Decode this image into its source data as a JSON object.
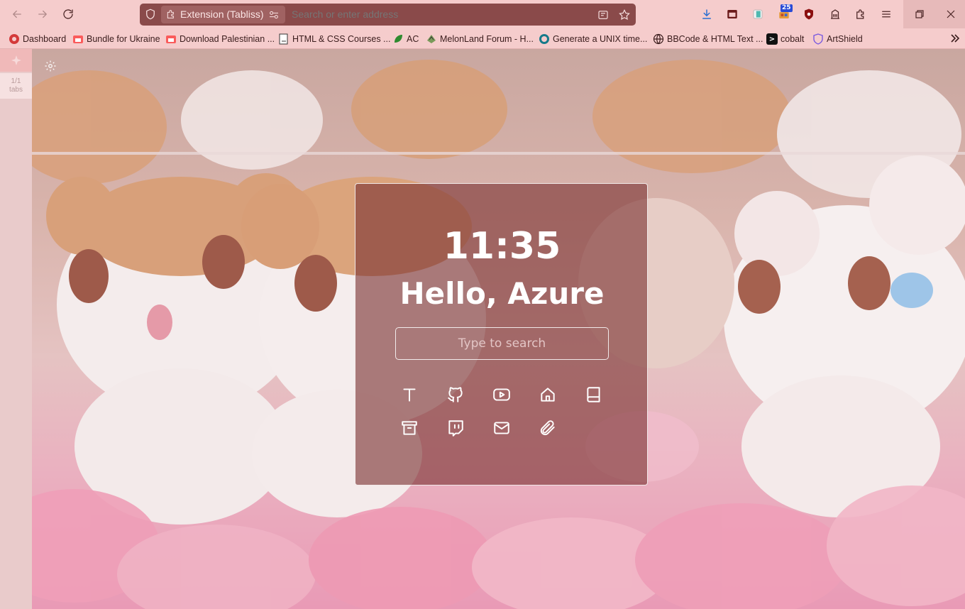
{
  "browser": {
    "identity_label": "Extension (Tabliss)",
    "url_placeholder": "Search or enter address",
    "download_badge": "25"
  },
  "bookmarks": [
    {
      "label": "Dashboard",
      "icon": "gear-red-icon"
    },
    {
      "label": "Bundle for Ukraine",
      "icon": "itch-icon"
    },
    {
      "label": "Download Palestinian ...",
      "icon": "itch-icon"
    },
    {
      "label": "HTML & CSS Courses ...",
      "icon": "page-icon"
    },
    {
      "label": "AC",
      "icon": "leaf-icon"
    },
    {
      "label": "MelonLand Forum - H...",
      "icon": "melon-icon"
    },
    {
      "label": "Generate a UNIX time...",
      "icon": "clock-teal-icon"
    },
    {
      "label": "BBCode & HTML Text ...",
      "icon": "globe-icon"
    },
    {
      "label": "cobalt",
      "icon": "terminal-icon"
    },
    {
      "label": "ArtShield",
      "icon": "shield-purple-icon"
    }
  ],
  "sidebar": {
    "tab_count": "1/1",
    "tab_word": "tabs"
  },
  "dashboard": {
    "time": "11:35",
    "greeting": "Hello, Azure",
    "search_placeholder": "Type to search",
    "links": [
      {
        "icon": "text-icon"
      },
      {
        "icon": "github-icon"
      },
      {
        "icon": "youtube-icon"
      },
      {
        "icon": "home-icon"
      },
      {
        "icon": "book-icon"
      },
      {
        "icon": "archive-icon"
      },
      {
        "icon": "twitch-icon"
      },
      {
        "icon": "mail-icon"
      },
      {
        "icon": "paperclip-icon"
      }
    ]
  },
  "colors": {
    "toolbar_bg": "#f5cccc",
    "urlbar_bg": "#8a4a4a",
    "panel_bg": "#7a3232"
  }
}
